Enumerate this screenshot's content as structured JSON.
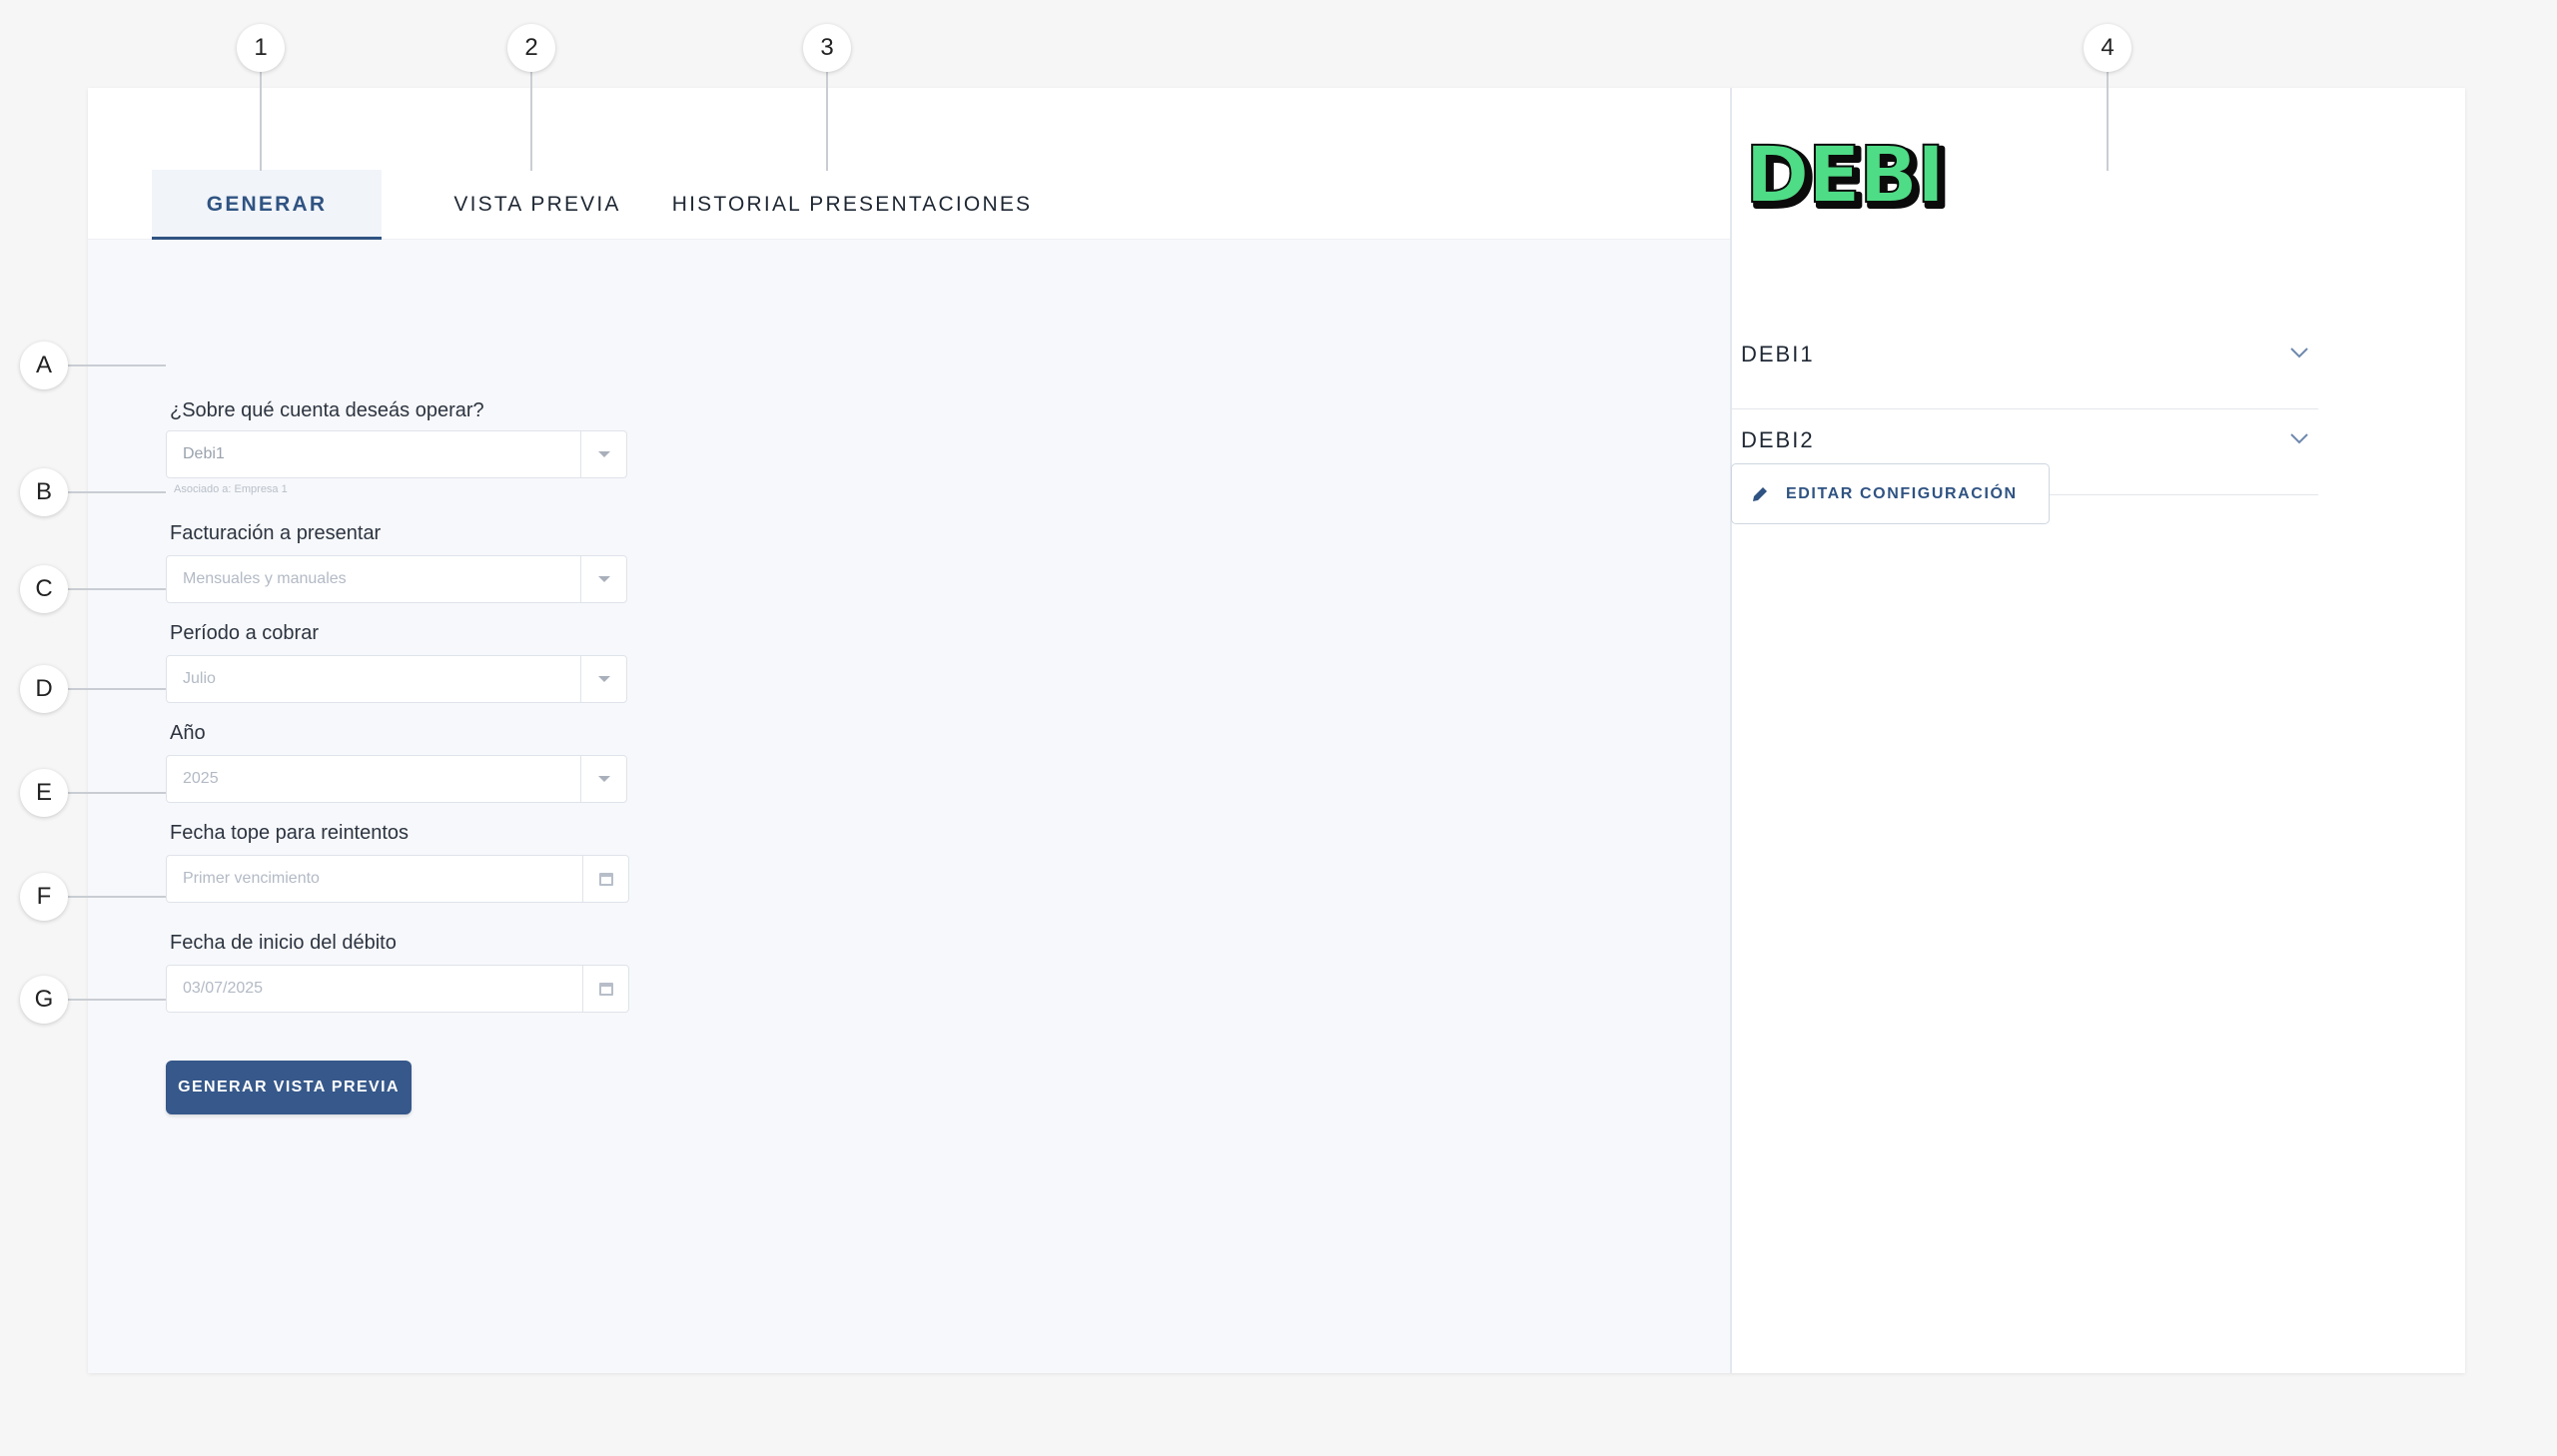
{
  "tabs": [
    {
      "label": "GENERAR",
      "active": true
    },
    {
      "label": "VISTA PREVIA",
      "active": false
    },
    {
      "label": "HISTORIAL PRESENTACIONES",
      "active": false
    }
  ],
  "form": {
    "account": {
      "label": "¿Sobre qué cuenta deseás operar?",
      "value": "Debi1",
      "hint": "Asociado a: Empresa 1"
    },
    "billing": {
      "label": "Facturación a presentar",
      "value": "Mensuales y manuales"
    },
    "period": {
      "label": "Período a cobrar",
      "value": "Julio"
    },
    "year": {
      "label": "Año",
      "value": "2025"
    },
    "retry_deadline": {
      "label": "Fecha tope para reintentos",
      "placeholder": "Primer vencimiento"
    },
    "debit_start": {
      "label": "Fecha de inicio del débito",
      "value": "03/07/2025"
    },
    "submit_label": "GENERAR VISTA PREVIA"
  },
  "sidebar": {
    "logo_text": "DEBI",
    "logo_color": "#4fdc86",
    "accounts": [
      {
        "label": "DEBI1"
      },
      {
        "label": "DEBI2"
      }
    ],
    "edit_label": "EDITAR CONFIGURACIÓN"
  },
  "callouts": {
    "top": [
      "1",
      "2",
      "3",
      "4"
    ],
    "left": [
      "A",
      "B",
      "C",
      "D",
      "E",
      "F",
      "G"
    ]
  },
  "colors": {
    "accent": "#2f5382",
    "primary_button": "#36588a",
    "logo_green": "#4fdc86"
  }
}
